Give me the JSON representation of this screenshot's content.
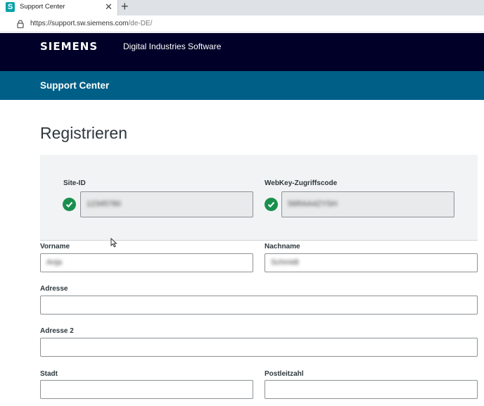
{
  "browser": {
    "tab_title": "Support Center",
    "tab_favicon": "S",
    "close_glyph": "✕",
    "new_tab_glyph": "+",
    "url_host": "https://support.sw.siemens.com",
    "url_path": "/de-DE/"
  },
  "header": {
    "logo": "SIEMENS",
    "division": "Digital Industries Software",
    "support_title": "Support Center",
    "bg_color": "#000028",
    "bar_color": "#005f87"
  },
  "page": {
    "title": "Registrieren"
  },
  "credentials": {
    "site_id_label": "Site-ID",
    "site_id_value": "12345780",
    "webkey_label": "WebKey-Zugriffscode",
    "webkey_value": "56RAA4ZYSH",
    "check_color": "#1a8f4d"
  },
  "form": {
    "first_name_label": "Vorname",
    "first_name_value": "Anja",
    "last_name_label": "Nachname",
    "last_name_value": "Schmidt",
    "address_label": "Adresse",
    "address_value": "",
    "address2_label": "Adresse 2",
    "address2_value": "",
    "city_label": "Stadt",
    "city_value": "",
    "zip_label": "Postleitzahl",
    "zip_value": ""
  }
}
